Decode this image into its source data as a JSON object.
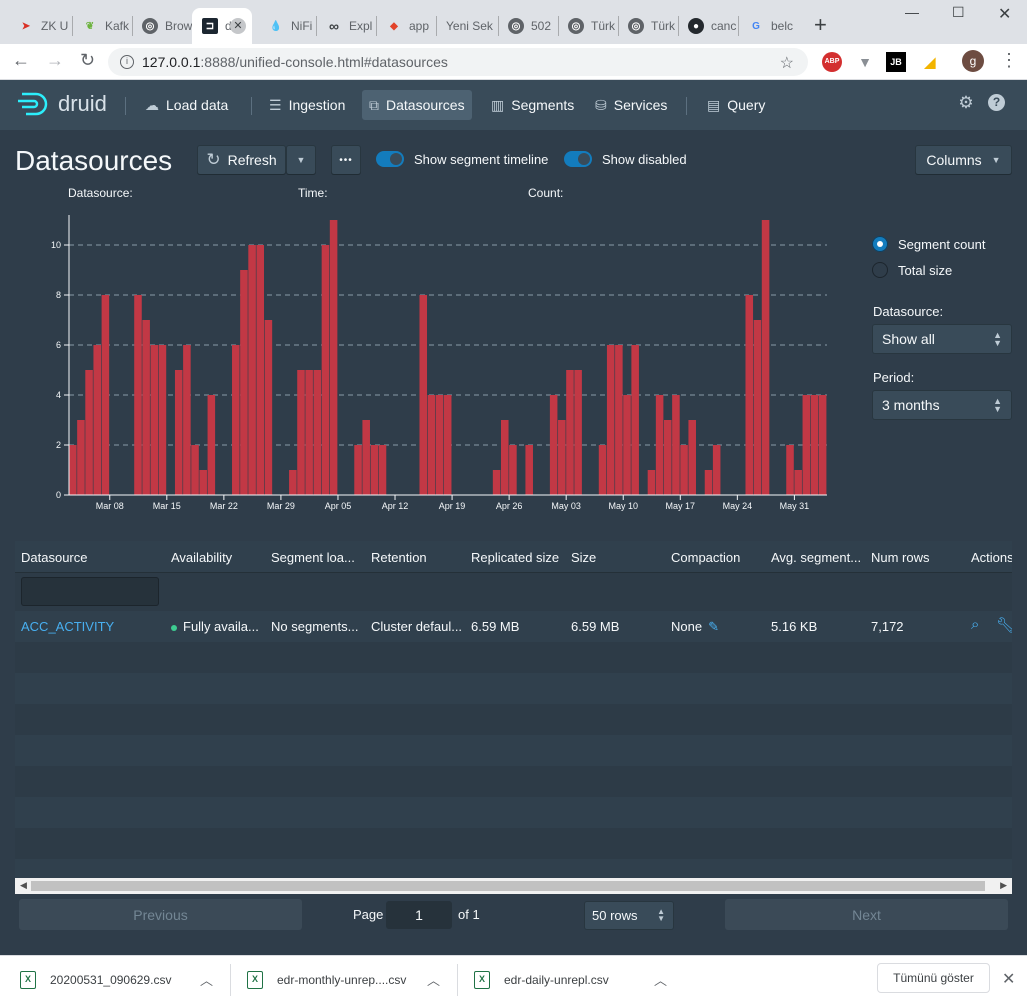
{
  "browser": {
    "tabs": [
      {
        "label": "ZK U",
        "favicon": "Z",
        "color": "#d93025"
      },
      {
        "label": "Kafk",
        "favicon": "K",
        "color": "#6db33f"
      },
      {
        "label": "Brow",
        "favicon": "◎",
        "color": "#5f6368"
      },
      {
        "label": "d",
        "favicon": "d",
        "color": "#1c2630"
      },
      {
        "label": "NiFi",
        "favicon": "N",
        "color": "#7aa7c7"
      },
      {
        "label": "Expl",
        "favicon": "∞",
        "color": "#3c4043"
      },
      {
        "label": "app",
        "favicon": "G",
        "color": "#e2432a"
      },
      {
        "label": "Yeni Sek",
        "favicon": "",
        "color": "#dee1e6"
      },
      {
        "label": "502",
        "favicon": "◎",
        "color": "#5f6368"
      },
      {
        "label": "Türk",
        "favicon": "◎",
        "color": "#5f6368"
      },
      {
        "label": "Türk",
        "favicon": "◎",
        "color": "#5f6368"
      },
      {
        "label": "canc",
        "favicon": "●",
        "color": "#24292e"
      },
      {
        "label": "belc",
        "favicon": "G",
        "color": "#4285f4"
      }
    ],
    "url_host": "127.0.0.1",
    "url_path": ":8888/unified-console.html#datasources",
    "profile_initial": "g",
    "ext_abp": "ABP",
    "ext_jb": "JB"
  },
  "nav": {
    "logo_text": "druid",
    "items": [
      {
        "label": "Load data",
        "icon": "cloud-upload-icon"
      },
      {
        "label": "Ingestion",
        "icon": "gantt-icon"
      },
      {
        "label": "Datasources",
        "icon": "datasource-icon"
      },
      {
        "label": "Segments",
        "icon": "segments-icon"
      },
      {
        "label": "Services",
        "icon": "database-icon"
      },
      {
        "label": "Query",
        "icon": "console-icon"
      }
    ]
  },
  "header": {
    "title": "Datasources",
    "refresh_label": "Refresh",
    "more_label": "•••",
    "toggle_timeline": "Show segment timeline",
    "toggle_disabled": "Show disabled",
    "columns_label": "Columns"
  },
  "chart_header": {
    "datasource_label": "Datasource:",
    "time_label": "Time:",
    "count_label": "Count:"
  },
  "controls": {
    "radio_count": "Segment count",
    "radio_size": "Total size",
    "datasource_label": "Datasource:",
    "datasource_value": "Show all",
    "period_label": "Period:",
    "period_value": "3 months"
  },
  "chart_data": {
    "type": "bar",
    "ylim": [
      0,
      11
    ],
    "yticks": [
      0,
      2,
      4,
      6,
      8,
      10
    ],
    "xtick_labels": [
      "Mar 08",
      "Mar 15",
      "Mar 22",
      "Mar 29",
      "Apr 05",
      "Apr 12",
      "Apr 19",
      "Apr 26",
      "May 03",
      "May 10",
      "May 17",
      "May 24",
      "May 31"
    ],
    "days": 89,
    "first_tick_day": 5,
    "bar_color": "#c23845",
    "values": [
      2,
      3,
      5,
      6,
      8,
      0,
      0,
      0,
      8,
      7,
      6,
      6,
      0,
      5,
      6,
      2,
      1,
      4,
      0,
      0,
      6,
      9,
      10,
      10,
      7,
      0,
      0,
      1,
      5,
      5,
      5,
      10,
      11,
      0,
      0,
      2,
      3,
      2,
      2,
      0,
      0,
      0,
      0,
      8,
      4,
      4,
      4,
      0,
      0,
      0,
      0,
      0,
      1,
      3,
      2,
      0,
      2,
      0,
      0,
      4,
      3,
      5,
      5,
      0,
      0,
      2,
      6,
      6,
      4,
      6,
      0,
      1,
      4,
      3,
      4,
      2,
      3,
      0,
      1,
      2,
      0,
      0,
      0,
      8,
      7,
      11,
      0,
      0,
      2,
      1,
      4,
      4,
      4
    ]
  },
  "table": {
    "columns": [
      "Datasource",
      "Availability",
      "Segment loa...",
      "Retention",
      "Replicated size",
      "Size",
      "Compaction",
      "Avg. segment...",
      "Num rows",
      "Actions"
    ],
    "row": {
      "datasource": "ACC_ACTIVITY",
      "availability": "Fully availa...",
      "segment_load": "No segments...",
      "retention": "Cluster defaul...",
      "replicated_size": "6.59 MB",
      "size": "6.59 MB",
      "compaction": "None",
      "avg_segment": "5.16 KB",
      "num_rows": "7,172"
    }
  },
  "pagination": {
    "previous": "Previous",
    "page_label": "Page",
    "page_value": "1",
    "of_label": "of 1",
    "rows_value": "50 rows",
    "next": "Next"
  },
  "downloads": {
    "items": [
      "20200531_090629.csv",
      "edr-monthly-unrep....csv",
      "edr-daily-unrepl.csv"
    ],
    "show_all": "Tümünü göster"
  }
}
